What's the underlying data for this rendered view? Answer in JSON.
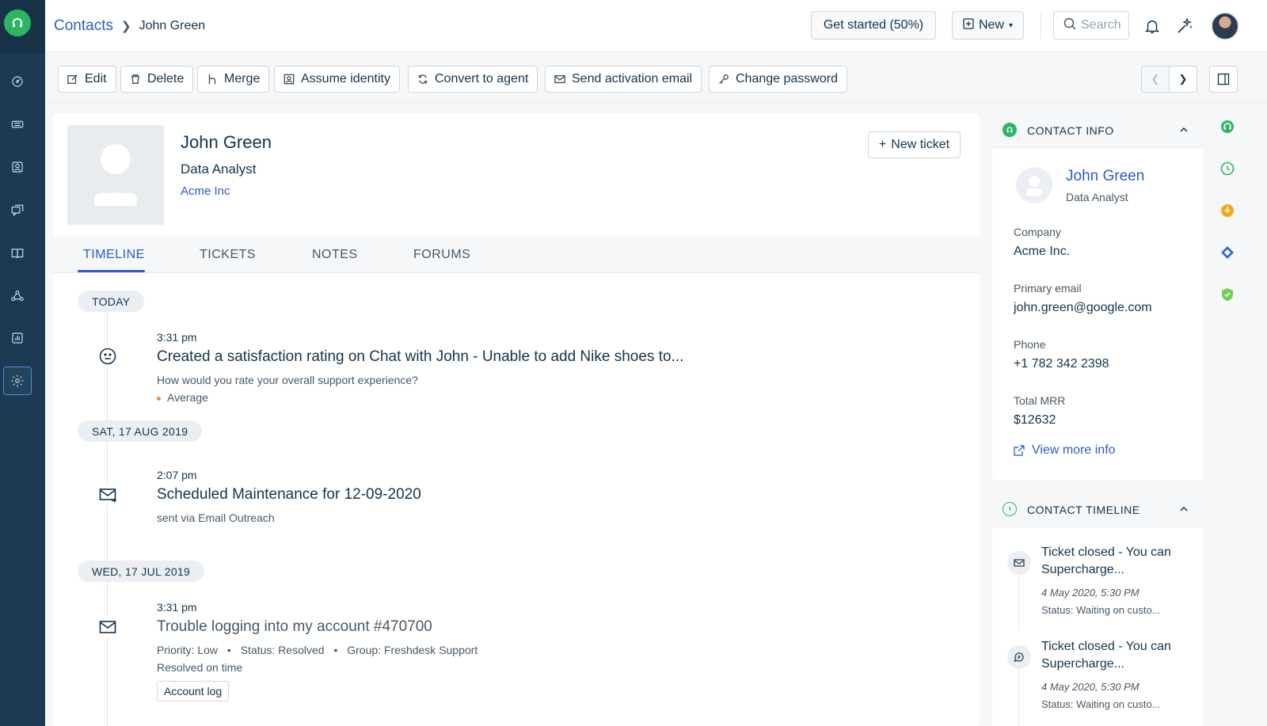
{
  "header": {
    "breadcrumb_root": "Contacts",
    "breadcrumb_current": "John Green",
    "get_started": "Get started (50%)",
    "new_label": "New",
    "search_placeholder": "Search"
  },
  "toolbar": {
    "edit": "Edit",
    "delete": "Delete",
    "merge": "Merge",
    "assume_identity": "Assume identity",
    "convert_to_agent": "Convert to agent",
    "send_activation": "Send activation email",
    "change_password": "Change password"
  },
  "profile": {
    "name": "John Green",
    "title": "Data Analyst",
    "company": "Acme Inc",
    "new_ticket": "New ticket"
  },
  "tabs": [
    "TIMELINE",
    "TICKETS",
    "NOTES",
    "FORUMS"
  ],
  "timeline": {
    "groups": [
      {
        "date": "TODAY"
      },
      {
        "date": "SAT, 17 AUG 2019"
      },
      {
        "date": "WED, 17 JUL 2019"
      }
    ],
    "events": [
      {
        "time": "3:31 pm",
        "title": "Created a satisfaction rating on Chat with John - Unable to add Nike shoes to...",
        "sub1": "How would you rate your overall support experience?",
        "sub2": "Average",
        "icon": "smiley-icon"
      },
      {
        "time": "2:07 pm",
        "title": "Scheduled Maintenance for 12-09-2020",
        "sub1": "sent via Email Outreach",
        "icon": "email-outreach-icon"
      },
      {
        "time": "3:31 pm",
        "title": "Trouble logging into my account #470700",
        "priority": "Priority: Low",
        "status": "Status: Resolved",
        "group": "Group: Freshdesk Support",
        "resolution": "Resolved on time",
        "account_log": "Account log",
        "icon": "envelope-icon"
      }
    ]
  },
  "contact_info": {
    "heading": "CONTACT INFO",
    "name": "John Green",
    "title": "Data Analyst",
    "company_label": "Company",
    "company_value": "Acme Inc.",
    "email_label": "Primary email",
    "email_value": "john.green@google.com",
    "phone_label": "Phone",
    "phone_value": "+1 782 342 2398",
    "mrr_label": "Total MRR",
    "mrr_value": "$12632",
    "view_more": "View more info"
  },
  "contact_timeline": {
    "heading": "CONTACT TIMELINE",
    "items": [
      {
        "title": "Ticket closed - You can Supercharge...",
        "date": "4 May 2020, 5:30 PM",
        "status": "Status: Waiting on custo..."
      },
      {
        "title": "Ticket closed - You can Supercharge...",
        "date": "4 May 2020, 5:30 PM",
        "status": "Status: Waiting on custo..."
      }
    ]
  },
  "colors": {
    "nav_bg": "#1c3a52",
    "brand_green": "#2cb664",
    "link_blue": "#2c5cc5",
    "text_dark": "#12344d"
  }
}
